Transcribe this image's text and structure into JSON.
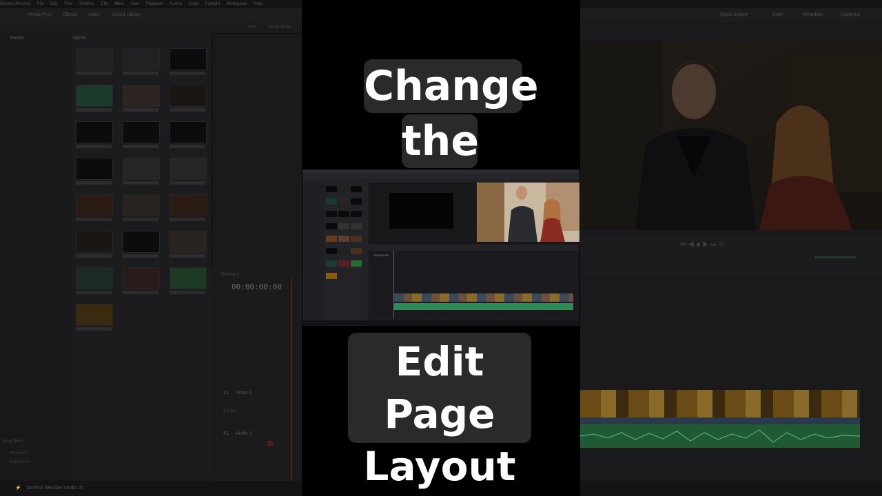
{
  "background_app": {
    "menu_items": [
      "DaVinci Resolve",
      "File",
      "Edit",
      "Trim",
      "Timeline",
      "Clip",
      "Mark",
      "View",
      "Playback",
      "Fusion",
      "Color",
      "Fairlight",
      "Workspace",
      "Help"
    ],
    "toolbar_items": [
      "Media Pool",
      "Effects",
      "Index",
      "Sound Library"
    ],
    "right_toolbar_items": [
      "Quick Export",
      "Mixer",
      "Metadata",
      "Inspector"
    ],
    "zoom": "29%",
    "panel_left_title": "Master",
    "panel_mid_title": "Name",
    "timecode_top": "00:00:00:00",
    "timecode_timeline": "00:00:00:00",
    "timeline_name": "Timeline 1",
    "track_video": "V1",
    "track_video_name": "Video 1",
    "track_video_clips": "9 Clips",
    "track_audio": "A1",
    "track_audio_name": "Audio 1",
    "smart_bins_title": "Smart Bins",
    "smart_bins_items": [
      "Keywords",
      "Collections"
    ],
    "status_app": "DaVinci Resolve Studio 20"
  },
  "caption": {
    "top_line1": "Change",
    "top_line2": "the",
    "bottom_line1": "Edit Page",
    "bottom_line2": "Layout"
  },
  "colors": {
    "caption_bg": "#2a2a2a",
    "caption_text": "#ffffff",
    "playhead": "#e03030",
    "audio_green": "#2f8a55"
  }
}
